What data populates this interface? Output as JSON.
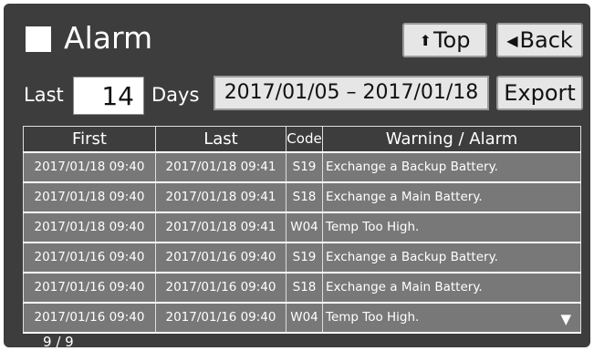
{
  "header": {
    "title": "Alarm",
    "top_label": "Top",
    "back_label": "Back"
  },
  "filter": {
    "last_label": "Last",
    "days_value": "14",
    "days_label": "Days",
    "range_start": "2017/01/05",
    "range_sep": "–",
    "range_end": "2017/01/18",
    "export_label": "Export"
  },
  "table": {
    "columns": [
      "First",
      "Last",
      "Code",
      "Warning / Alarm"
    ],
    "rows": [
      {
        "first": "2017/01/18 09:40",
        "last": "2017/01/18 09:41",
        "code": "S19",
        "message": "Exchange a Backup Battery."
      },
      {
        "first": "2017/01/18 09:40",
        "last": "2017/01/18 09:41",
        "code": "S18",
        "message": "Exchange a Main Battery."
      },
      {
        "first": "2017/01/18 09:40",
        "last": "2017/01/18 09:41",
        "code": "W04",
        "message": "Temp Too High."
      },
      {
        "first": "2017/01/16 09:40",
        "last": "2017/01/16 09:40",
        "code": "S19",
        "message": "Exchange a Backup Battery."
      },
      {
        "first": "2017/01/16 09:40",
        "last": "2017/01/16 09:40",
        "code": "S18",
        "message": "Exchange a Main Battery."
      },
      {
        "first": "2017/01/16 09:40",
        "last": "2017/01/16 09:40",
        "code": "W04",
        "message": "Temp Too High."
      }
    ]
  },
  "pagination": {
    "current": "9",
    "separator": "/",
    "total": "9"
  },
  "icons": {
    "title": "square-icon",
    "top": "up-arrow-icon",
    "back": "left-arrow-icon",
    "scroll": "down-triangle-icon"
  }
}
